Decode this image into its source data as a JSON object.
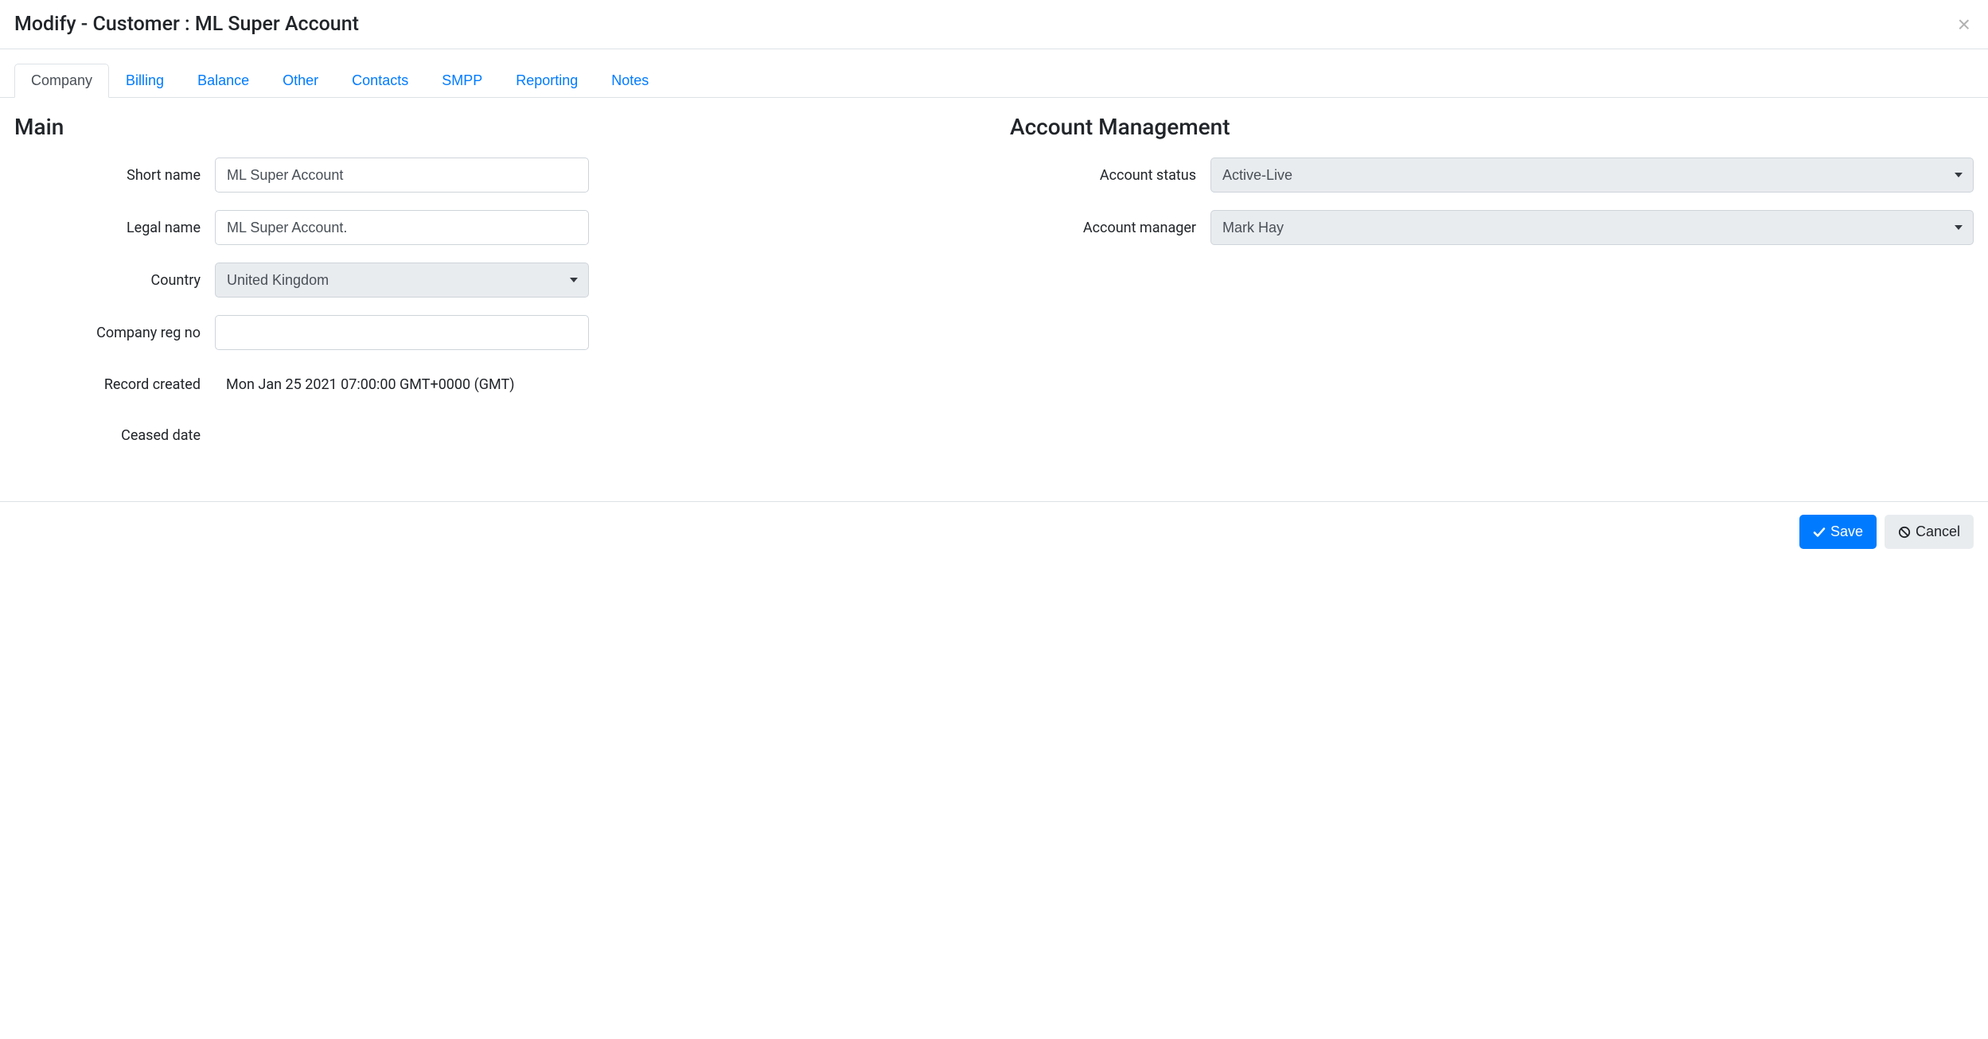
{
  "header": {
    "title": "Modify - Customer : ML Super Account"
  },
  "tabs": [
    {
      "label": "Company",
      "active": true
    },
    {
      "label": "Billing"
    },
    {
      "label": "Balance"
    },
    {
      "label": "Other"
    },
    {
      "label": "Contacts"
    },
    {
      "label": "SMPP"
    },
    {
      "label": "Reporting"
    },
    {
      "label": "Notes"
    }
  ],
  "sections": {
    "main": {
      "title": "Main",
      "fields": {
        "short_name": {
          "label": "Short name",
          "value": "ML Super Account"
        },
        "legal_name": {
          "label": "Legal name",
          "value": "ML Super Account."
        },
        "country": {
          "label": "Country",
          "value": "United Kingdom"
        },
        "company_reg": {
          "label": "Company reg no",
          "value": ""
        },
        "record_created": {
          "label": "Record created",
          "value": "Mon Jan 25 2021 07:00:00 GMT+0000 (GMT)"
        },
        "ceased_date": {
          "label": "Ceased date",
          "value": ""
        }
      }
    },
    "account_mgmt": {
      "title": "Account Management",
      "fields": {
        "status": {
          "label": "Account status",
          "value": "Active-Live"
        },
        "manager": {
          "label": "Account manager",
          "value": "Mark Hay"
        }
      }
    }
  },
  "footer": {
    "save": "Save",
    "cancel": "Cancel"
  }
}
